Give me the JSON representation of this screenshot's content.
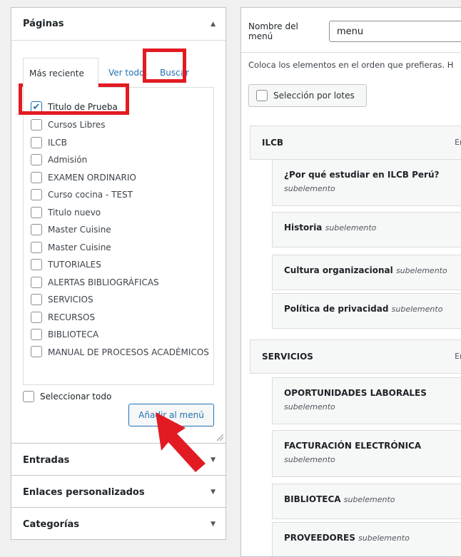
{
  "left": {
    "pages_box": {
      "title": "Páginas",
      "tabs": {
        "recent": "Más reciente",
        "all": "Ver todo",
        "search": "Buscar"
      },
      "items": [
        {
          "label": "Titulo de Prueba",
          "checked": true
        },
        {
          "label": "Cursos Libres",
          "checked": false
        },
        {
          "label": "ILCB",
          "checked": false
        },
        {
          "label": "Admisión",
          "checked": false
        },
        {
          "label": "EXAMEN ORDINARIO",
          "checked": false
        },
        {
          "label": "Curso cocina - TEST",
          "checked": false
        },
        {
          "label": "Titulo nuevo",
          "checked": false
        },
        {
          "label": "Master Cuisine",
          "checked": false
        },
        {
          "label": "Master Cuisine",
          "checked": false
        },
        {
          "label": "TUTORIALES",
          "checked": false
        },
        {
          "label": "ALERTAS BIBLIOGRÁFICAS",
          "checked": false
        },
        {
          "label": "SERVICIOS",
          "checked": false
        },
        {
          "label": "RECURSOS",
          "checked": false
        },
        {
          "label": "BIBLIOTECA",
          "checked": false
        },
        {
          "label": "MANUAL DE PROCESOS ACADÉMICOS",
          "checked": false
        }
      ],
      "select_all": "Seleccionar todo",
      "add_button": "Añadir al menú"
    },
    "collapsed_boxes": [
      {
        "title": "Entradas"
      },
      {
        "title": "Enlaces personalizados"
      },
      {
        "title": "Categorías"
      }
    ]
  },
  "right": {
    "menu_name_label": "Nombre del menú",
    "menu_name_value": "menu",
    "instructions": "Coloca los elementos en el orden que prefieras. H",
    "bulk_select": "Selección por lotes",
    "sub_label": "subelemento",
    "menu_items": [
      {
        "title": "ILCB",
        "type": "En",
        "level": 0
      },
      {
        "title": "¿Por qué estudiar en ILCB Perú?",
        "level": 1,
        "wrap": true
      },
      {
        "title": "Historia",
        "level": 1
      },
      {
        "title": "Cultura organizacional",
        "level": 1
      },
      {
        "title": "Política de privacidad",
        "level": 1
      },
      {
        "title": "SERVICIOS",
        "type": "En",
        "level": 0
      },
      {
        "title": "OPORTUNIDADES LABORALES",
        "level": 1,
        "wrap": true
      },
      {
        "title": "FACTURACIÓN ELECTRÓNICA",
        "level": 1,
        "wrap": true
      },
      {
        "title": "BIBLIOTECA",
        "level": 1
      },
      {
        "title": "PROVEEDORES",
        "level": 1
      }
    ]
  },
  "colors": {
    "highlight": "#e21b23",
    "link": "#2271b1"
  },
  "icons": {
    "collapse": "triangle-up-icon",
    "expand": "triangle-down-icon",
    "checkbox": "checkmark-icon",
    "annotation": "red-arrow-icon"
  }
}
